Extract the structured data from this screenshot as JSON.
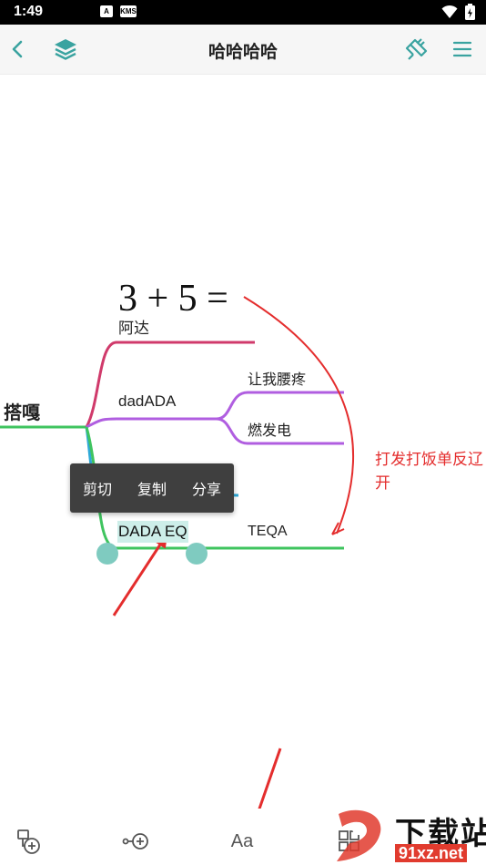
{
  "status_bar": {
    "time": "1:49",
    "icon_a": "A",
    "icon_kms": "KMS"
  },
  "toolbar": {
    "title": "哈哈哈哈"
  },
  "mindmap": {
    "root": "搭嘎",
    "formula": "3 + 5 =",
    "branches": [
      {
        "label": "阿达",
        "color": "#d03a6b"
      },
      {
        "label": "dadADA",
        "color": "#b05ee0",
        "children": [
          "让我腰疼",
          "燃发电"
        ]
      },
      {
        "label": "DADA EQ",
        "color": "#3fc45f",
        "children": [
          "TEQA"
        ]
      }
    ],
    "annotation_line1": "打发打饭单反辽",
    "annotation_line2": "开"
  },
  "context_menu": {
    "cut": "剪切",
    "copy": "复制",
    "share": "分享"
  },
  "bottom_bar": {
    "font_label": "Aa"
  },
  "watermark": {
    "text": "下载站",
    "url": "91xz.net"
  },
  "colors": {
    "accent": "#3aa3a0",
    "root_branch": "#3fc45f",
    "annotation": "#e42d2d",
    "selection": "#cdeee9",
    "handle": "#7fcbc0"
  }
}
